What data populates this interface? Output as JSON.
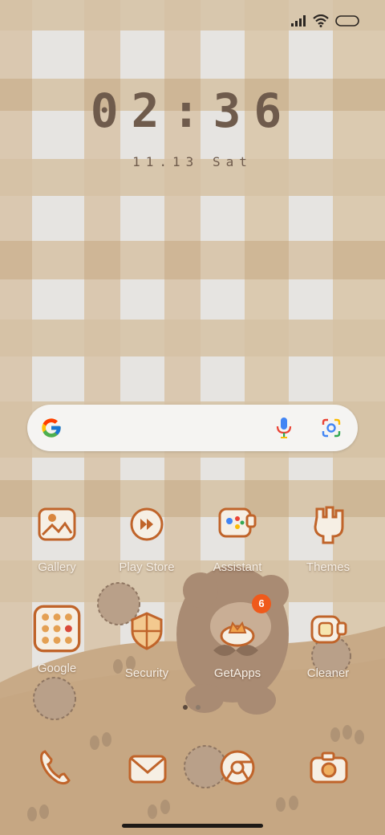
{
  "status_bar": {
    "signal_icon": "signal-bars-icon",
    "wifi_icon": "wifi-icon",
    "battery_icon": "battery-icon"
  },
  "lockclock": {
    "time": "02:36",
    "date": "11.13 Sat"
  },
  "search_widget": {
    "logo_icon": "google-g-icon",
    "mic_icon": "microphone-icon",
    "lens_icon": "google-lens-icon"
  },
  "apps_row1": [
    {
      "label": "Gallery",
      "icon": "gallery-icon"
    },
    {
      "label": "Play Store",
      "icon": "play-store-icon"
    },
    {
      "label": "Assistant",
      "icon": "assistant-icon"
    },
    {
      "label": "Themes",
      "icon": "themes-icon"
    }
  ],
  "apps_row2": [
    {
      "label": "Google",
      "icon": "google-folder-icon"
    },
    {
      "label": "Security",
      "icon": "security-icon"
    },
    {
      "label": "GetApps",
      "icon": "getapps-icon",
      "badge": "6"
    },
    {
      "label": "Cleaner",
      "icon": "cleaner-icon"
    }
  ],
  "page_indicator": {
    "pages": 2,
    "current": 1
  },
  "dock": [
    {
      "icon": "phone-icon"
    },
    {
      "icon": "messages-icon"
    },
    {
      "icon": "chrome-icon"
    },
    {
      "icon": "camera-icon"
    }
  ],
  "colors": {
    "icon_fill": "#f6efe4",
    "icon_stroke": "#c0642a",
    "clock_text": "#6f5b4c",
    "badge": "#ef5a1c",
    "wallpaper_check_light": "#e9e9e9",
    "wallpaper_check_dark": "#d3c0a4",
    "ground": "#c9ab8a"
  }
}
